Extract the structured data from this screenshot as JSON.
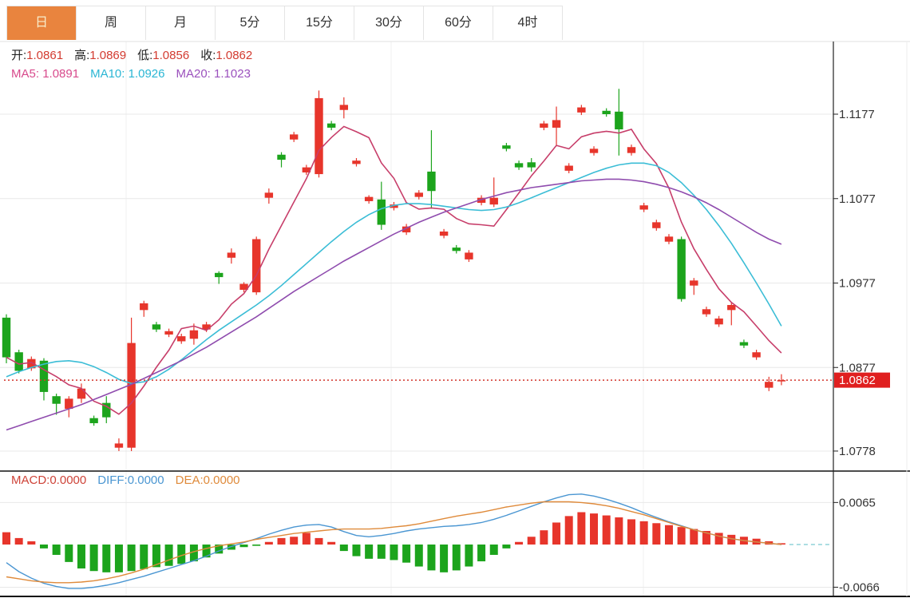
{
  "toolbar": {
    "tabs": [
      {
        "id": "day",
        "label": "日",
        "active": true
      },
      {
        "id": "week",
        "label": "周",
        "active": false
      },
      {
        "id": "month",
        "label": "月",
        "active": false
      },
      {
        "id": "5min",
        "label": "5分",
        "active": false
      },
      {
        "id": "15min",
        "label": "15分",
        "active": false
      },
      {
        "id": "30min",
        "label": "30分",
        "active": false
      },
      {
        "id": "60min",
        "label": "60分",
        "active": false
      },
      {
        "id": "4hour",
        "label": "4时",
        "active": false
      }
    ]
  },
  "legend_ohlc": [
    {
      "label": "开:",
      "value": "1.0861"
    },
    {
      "label": "高:",
      "value": "1.0869"
    },
    {
      "label": "低:",
      "value": "1.0856"
    },
    {
      "label": "收:",
      "value": "1.0862"
    }
  ],
  "legend_ma": [
    {
      "label": "MA5: ",
      "value": "1.0891",
      "color": "#d84a8c"
    },
    {
      "label": "MA10: ",
      "value": "1.0926",
      "color": "#2ab6d4"
    },
    {
      "label": "MA20: ",
      "value": "1.1023",
      "color": "#9b51bd"
    }
  ],
  "legend_macd": [
    {
      "label": "MACD:",
      "value": "0.0000",
      "color": "#ce4338"
    },
    {
      "label": "DIFF:",
      "value": "0.0000",
      "color": "#4a96d2"
    },
    {
      "label": "DEA:",
      "value": "0.0000",
      "color": "#df8a3a"
    }
  ],
  "price_tag": "1.0862",
  "colors": {
    "up": "#e7352b",
    "down": "#1ca41c",
    "ma5": "#c73e6a",
    "ma10": "#3bbdd6",
    "ma20": "#8f4cae",
    "diff": "#4a96d2",
    "dea": "#df8a3a",
    "close_line": "#d2342b",
    "tag_bg": "#e01f1f",
    "tag_text": "#ffffff",
    "grid": "#e8e8e8",
    "grid_light": "#f0f0f0",
    "axis": "#222222",
    "label": "#333333",
    "dash_ext": "#8fd2d8",
    "accent_tab": "#e9843e"
  },
  "chart_data": [
    {
      "type": "candlestick",
      "panel": "main",
      "y_axis": {
        "side": "right",
        "ticks": [
          "1.1177",
          "1.1077",
          "1.0977",
          "1.0877",
          "1.0778"
        ]
      },
      "last_price_line": 1.0862,
      "series": [
        {
          "name": "K",
          "type": "candlestick",
          "candles": [
            [
              1.0936,
              1.094,
              1.0882,
              1.0889
            ],
            [
              1.0895,
              1.0898,
              1.087,
              1.0873
            ],
            [
              1.0876,
              1.089,
              1.0873,
              1.0887
            ],
            [
              1.0885,
              1.0888,
              1.0838,
              1.0848
            ],
            [
              1.0843,
              1.0846,
              1.0821,
              1.0834
            ],
            [
              1.0828,
              1.0843,
              1.0818,
              1.084
            ],
            [
              1.084,
              1.0858,
              1.0835,
              1.0852
            ],
            [
              1.0817,
              1.082,
              1.0808,
              1.0811
            ],
            [
              1.0835,
              1.0843,
              1.0811,
              1.0818
            ],
            [
              1.0782,
              1.0793,
              1.0778,
              1.0787
            ],
            [
              1.0782,
              1.0936,
              1.0778,
              1.0906
            ],
            [
              1.0945,
              1.0956,
              1.0937,
              1.0953
            ],
            [
              1.0928,
              1.0931,
              1.0919,
              1.0922
            ],
            [
              1.0916,
              1.0923,
              1.0913,
              1.092
            ],
            [
              1.0908,
              1.0917,
              1.0905,
              1.0914
            ],
            [
              1.0911,
              1.0929,
              1.0904,
              1.0921
            ],
            [
              1.0922,
              1.0931,
              1.0919,
              1.0928
            ],
            [
              1.0989,
              1.0991,
              1.0976,
              1.0984
            ],
            [
              1.1007,
              1.1018,
              1.1,
              1.1013
            ],
            [
              1.0969,
              1.0978,
              1.0966,
              1.0976
            ],
            [
              1.0966,
              1.1032,
              1.0963,
              1.1029
            ],
            [
              1.1078,
              1.1089,
              1.1071,
              1.1084
            ],
            [
              1.1129,
              1.1132,
              1.1114,
              1.1123
            ],
            [
              1.1147,
              1.1156,
              1.1144,
              1.1153
            ],
            [
              1.1108,
              1.1117,
              1.1105,
              1.1114
            ],
            [
              1.1106,
              1.1205,
              1.1102,
              1.1196
            ],
            [
              1.1166,
              1.1169,
              1.1158,
              1.1161
            ],
            [
              1.1182,
              1.1197,
              1.1172,
              1.1188
            ],
            [
              1.1118,
              1.1125,
              1.1115,
              1.1122
            ],
            [
              1.1074,
              1.1081,
              1.1071,
              1.1079
            ],
            [
              1.1076,
              1.1097,
              1.104,
              1.1046
            ],
            [
              1.1066,
              1.1073,
              1.1063,
              1.107
            ],
            [
              1.1037,
              1.1047,
              1.1034,
              1.1044
            ],
            [
              1.1079,
              1.1087,
              1.1076,
              1.1084
            ],
            [
              1.1109,
              1.1158,
              1.1065,
              1.1086
            ],
            [
              1.1033,
              1.1041,
              1.103,
              1.1038
            ],
            [
              1.1019,
              1.1022,
              1.1012,
              1.1015
            ],
            [
              1.1005,
              1.1016,
              1.1002,
              1.1013
            ],
            [
              1.1072,
              1.1081,
              1.1069,
              1.1078
            ],
            [
              1.107,
              1.1102,
              1.1067,
              1.1078
            ],
            [
              1.114,
              1.1143,
              1.1133,
              1.1136
            ],
            [
              1.1119,
              1.1122,
              1.1111,
              1.1114
            ],
            [
              1.112,
              1.1125,
              1.1109,
              1.1114
            ],
            [
              1.1161,
              1.1169,
              1.1158,
              1.1166
            ],
            [
              1.1161,
              1.1186,
              1.1139,
              1.117
            ],
            [
              1.111,
              1.1119,
              1.1107,
              1.1116
            ],
            [
              1.1179,
              1.1188,
              1.1176,
              1.1185
            ],
            [
              1.1131,
              1.1139,
              1.1128,
              1.1136
            ],
            [
              1.1181,
              1.1184,
              1.1174,
              1.1177
            ],
            [
              1.118,
              1.1207,
              1.1128,
              1.1159
            ],
            [
              1.1131,
              1.1141,
              1.1128,
              1.1138
            ],
            [
              1.1064,
              1.1072,
              1.1061,
              1.1069
            ],
            [
              1.1042,
              1.1052,
              1.1039,
              1.1049
            ],
            [
              1.1026,
              1.1035,
              1.1023,
              1.1032
            ],
            [
              1.1029,
              1.1032,
              1.0955,
              1.0958
            ],
            [
              1.0974,
              1.0983,
              1.0963,
              1.098
            ],
            [
              1.094,
              1.0949,
              1.0937,
              1.0946
            ],
            [
              1.0928,
              1.0938,
              1.0925,
              1.0935
            ],
            [
              1.0945,
              1.0954,
              1.0927,
              1.0951
            ],
            [
              1.0907,
              1.091,
              1.09,
              1.0903
            ],
            [
              1.0889,
              1.0898,
              1.0886,
              1.0895
            ],
            [
              1.0853,
              1.0866,
              1.0849,
              1.086
            ],
            [
              1.0861,
              1.0869,
              1.0856,
              1.0862
            ]
          ]
        },
        {
          "name": "MA5",
          "type": "line",
          "values": [
            1.0889,
            1.0881,
            1.0883,
            1.08743,
            1.08662,
            1.08564,
            1.08522,
            1.0837,
            1.0831,
            1.08216,
            1.08348,
            1.0855,
            1.08772,
            1.08976,
            1.0923,
            1.0926,
            1.0921,
            1.09334,
            1.0952,
            1.09644,
            1.0986,
            1.10172,
            1.1045,
            1.1073,
            1.11006,
            1.1134,
            1.11494,
            1.11624,
            1.11562,
            1.11492,
            1.11192,
            1.1101,
            1.10722,
            1.10646,
            1.1066,
            1.10644,
            1.10534,
            1.10472,
            1.1046,
            1.10444,
            1.1064,
            1.10838,
            1.1104,
            1.11216,
            1.114,
            1.1136,
            1.11502,
            1.11546,
            1.11568,
            1.11546,
            1.1159,
            1.11358,
            1.11184,
            1.10894,
            1.10492,
            1.10176,
            1.0993,
            1.09702,
            1.0954,
            1.0943,
            1.0926,
            1.09088,
            1.08942
          ]
        },
        {
          "name": "MA10",
          "type": "line",
          "values": [
            1.0866,
            1.0872,
            1.0877,
            1.0881,
            1.0884,
            1.0885,
            1.0883,
            1.0878,
            1.0871,
            1.0863,
            1.0858,
            1.086,
            1.0866,
            1.0875,
            1.0886,
            1.0898,
            1.091,
            1.0921,
            1.0931,
            1.0941,
            1.0951,
            1.0962,
            1.0974,
            1.0987,
            1.1,
            1.1013,
            1.1026,
            1.1038,
            1.1049,
            1.1058,
            1.1065,
            1.1069,
            1.1071,
            1.1071,
            1.107,
            1.1068,
            1.1066,
            1.1064,
            1.1063,
            1.1064,
            1.1067,
            1.1072,
            1.1078,
            1.1084,
            1.109,
            1.1096,
            1.1102,
            1.1108,
            1.1113,
            1.1117,
            1.1119,
            1.1119,
            1.1116,
            1.1108,
            1.1096,
            1.1081,
            1.1064,
            1.1045,
            1.1024,
            1.1001,
            1.0977,
            1.0952,
            1.0926
          ]
        },
        {
          "name": "MA20",
          "type": "line",
          "values": [
            1.0803,
            1.0808,
            1.0813,
            1.0818,
            1.0823,
            1.0828,
            1.0833,
            1.0839,
            1.0845,
            1.0851,
            1.0857,
            1.0864,
            1.0871,
            1.0878,
            1.0885,
            1.0893,
            1.0901,
            1.091,
            1.0919,
            1.0928,
            1.0937,
            1.0947,
            1.0957,
            1.0967,
            1.0976,
            1.0985,
            1.0994,
            1.1003,
            1.1011,
            1.1019,
            1.1027,
            1.1035,
            1.1042,
            1.1049,
            1.1055,
            1.1061,
            1.1066,
            1.1071,
            1.1076,
            1.108,
            1.1084,
            1.1087,
            1.109,
            1.1092,
            1.1094,
            1.1096,
            1.1098,
            1.1099,
            1.11,
            1.11,
            1.1099,
            1.1097,
            1.1094,
            1.109,
            1.1085,
            1.1079,
            1.1072,
            1.1064,
            1.1055,
            1.1046,
            1.1037,
            1.1029,
            1.1023
          ]
        }
      ]
    },
    {
      "type": "bar",
      "panel": "macd",
      "y_axis": {
        "side": "right",
        "ticks": [
          "0.0065",
          "-0.0066"
        ]
      },
      "series": [
        {
          "name": "MACD",
          "type": "bar",
          "values": [
            0.0019,
            0.001,
            0.0005,
            -0.0006,
            -0.0016,
            -0.0027,
            -0.0037,
            -0.0041,
            -0.0043,
            -0.0043,
            -0.0041,
            -0.0038,
            -0.0035,
            -0.0033,
            -0.003,
            -0.0026,
            -0.002,
            -0.0014,
            -0.0008,
            -0.0004,
            -0.0002,
            0.0004,
            0.001,
            0.0012,
            0.0018,
            0.001,
            0.0004,
            -0.001,
            -0.0018,
            -0.0022,
            -0.0022,
            -0.0024,
            -0.0028,
            -0.0034,
            -0.004,
            -0.0043,
            -0.004,
            -0.0034,
            -0.0026,
            -0.0016,
            -0.0006,
            0.0004,
            0.0012,
            0.0022,
            0.0034,
            0.0044,
            0.005,
            0.0048,
            0.0045,
            0.0042,
            0.0039,
            0.0036,
            0.0033,
            0.003,
            0.0027,
            0.0024,
            0.0021,
            0.0018,
            0.0015,
            0.0012,
            0.0009,
            0.0005,
            0.0002
          ]
        },
        {
          "name": "DIFF",
          "type": "line",
          "values": [
            -0.0028,
            -0.0042,
            -0.0052,
            -0.006,
            -0.0065,
            -0.0068,
            -0.0068,
            -0.0066,
            -0.0063,
            -0.0059,
            -0.0054,
            -0.0049,
            -0.0043,
            -0.0037,
            -0.0031,
            -0.0025,
            -0.0018,
            -0.001,
            -0.0003,
            0.0003,
            0.0009,
            0.0016,
            0.0022,
            0.0027,
            0.003,
            0.0031,
            0.0027,
            0.002,
            0.0014,
            0.0012,
            0.0014,
            0.0017,
            0.0021,
            0.0024,
            0.0026,
            0.0028,
            0.0029,
            0.0031,
            0.0034,
            0.0039,
            0.0045,
            0.0052,
            0.0059,
            0.0066,
            0.0072,
            0.0077,
            0.0078,
            0.0075,
            0.007,
            0.0064,
            0.0057,
            0.0049,
            0.0042,
            0.0035,
            0.0029,
            0.0023,
            0.0018,
            0.0013,
            0.0009,
            0.0006,
            0.0004,
            0.0002,
            0.0
          ]
        },
        {
          "name": "DEA",
          "type": "line",
          "values": [
            -0.005,
            -0.0053,
            -0.0056,
            -0.0058,
            -0.0059,
            -0.0059,
            -0.0058,
            -0.0056,
            -0.0053,
            -0.0049,
            -0.0044,
            -0.0038,
            -0.0031,
            -0.0024,
            -0.0017,
            -0.0011,
            -0.0006,
            -0.0002,
            0.0001,
            0.0004,
            0.0008,
            0.0011,
            0.0014,
            0.0017,
            0.0019,
            0.0021,
            0.0023,
            0.0024,
            0.0024,
            0.0024,
            0.0025,
            0.0027,
            0.0029,
            0.0032,
            0.0036,
            0.004,
            0.0044,
            0.0047,
            0.005,
            0.0054,
            0.0058,
            0.0061,
            0.0064,
            0.0066,
            0.0066,
            0.0066,
            0.0065,
            0.0063,
            0.006,
            0.0056,
            0.0051,
            0.0046,
            0.004,
            0.0034,
            0.0028,
            0.0023,
            0.0018,
            0.0013,
            0.0009,
            0.0006,
            0.0004,
            0.0002,
            0.0
          ]
        }
      ]
    }
  ]
}
